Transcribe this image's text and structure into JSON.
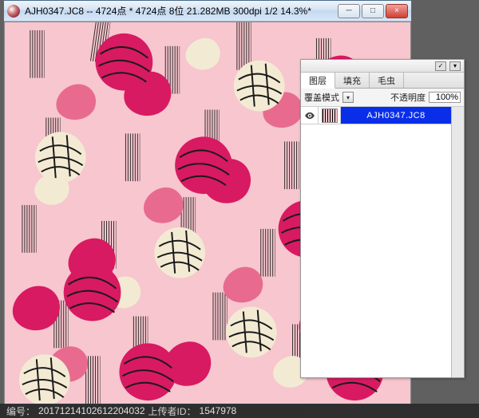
{
  "window": {
    "title": "AJH0347.JC8 -- 4724点 * 4724点 8位  21.282MB 300dpi 1/2  14.3%*",
    "min_label": "─",
    "max_label": "□",
    "close_label": "×"
  },
  "pattern": {
    "bg": "#f7c6ce",
    "ink": "#1a1a1a",
    "cream": "#f3ead4",
    "magenta": "#d81a62",
    "rose": "#e86b8f"
  },
  "panel": {
    "menu_label": "▾",
    "pin_label": "✓",
    "tabs": [
      {
        "label": "图层",
        "active": true
      },
      {
        "label": "填充",
        "active": false
      },
      {
        "label": "毛虫",
        "active": false
      }
    ],
    "mode_label": "覆盖模式",
    "mode_dropdown": "▾",
    "opacity_label": "不透明度",
    "opacity_value": "100%",
    "layer": {
      "name": "AJH0347.JC8"
    }
  },
  "footer": {
    "id_label": "编号：",
    "id_value": "20171214102612204032",
    "uploader_label": "上传者ID：",
    "uploader_value": "1547978"
  }
}
